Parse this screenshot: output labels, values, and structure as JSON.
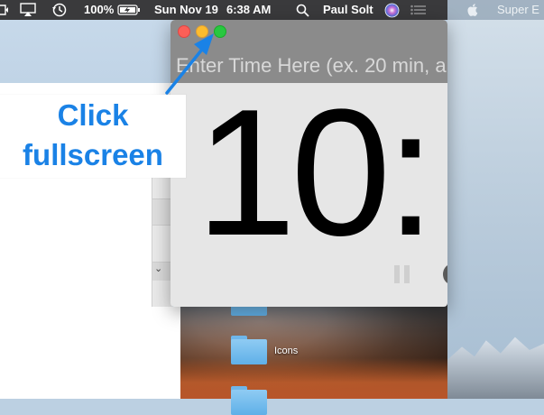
{
  "menubar": {
    "battery": "100%",
    "date": "Sun Nov 19",
    "time": "6:38 AM",
    "user": "Paul Solt"
  },
  "other_space": {
    "app_name": "Super E"
  },
  "timer": {
    "input_placeholder": "Enter Time Here (ex. 20 min, a",
    "display": "10:"
  },
  "callout": {
    "line1": "Click",
    "line2": "fullscreen"
  },
  "desktop": {
    "folders": [
      {
        "label": ""
      },
      {
        "label": "Icons"
      },
      {
        "label": ""
      }
    ]
  },
  "colors": {
    "callout_text": "#1a82e6",
    "arrow": "#1a82e6",
    "traffic_red": "#fc5f57",
    "traffic_yellow": "#fdbc2e",
    "traffic_green": "#28c840"
  }
}
